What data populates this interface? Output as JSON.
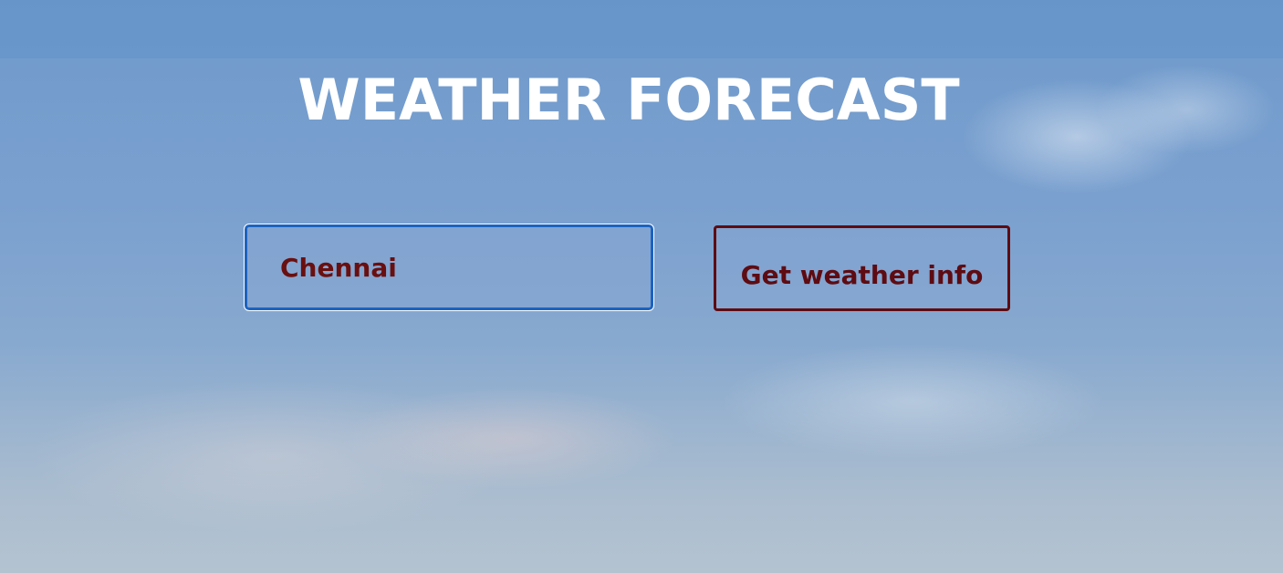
{
  "header": {
    "title": "WEATHER FORECAST"
  },
  "search": {
    "city_value": "Chennai"
  },
  "actions": {
    "get_weather_label": "Get weather info"
  },
  "colors": {
    "title": "#ffffff",
    "input_border": "#1b63c1",
    "input_text": "#6a0f0f",
    "button_border": "#5e0b12",
    "button_text": "#5e0b12",
    "sky_background": "#7aa0cf"
  }
}
